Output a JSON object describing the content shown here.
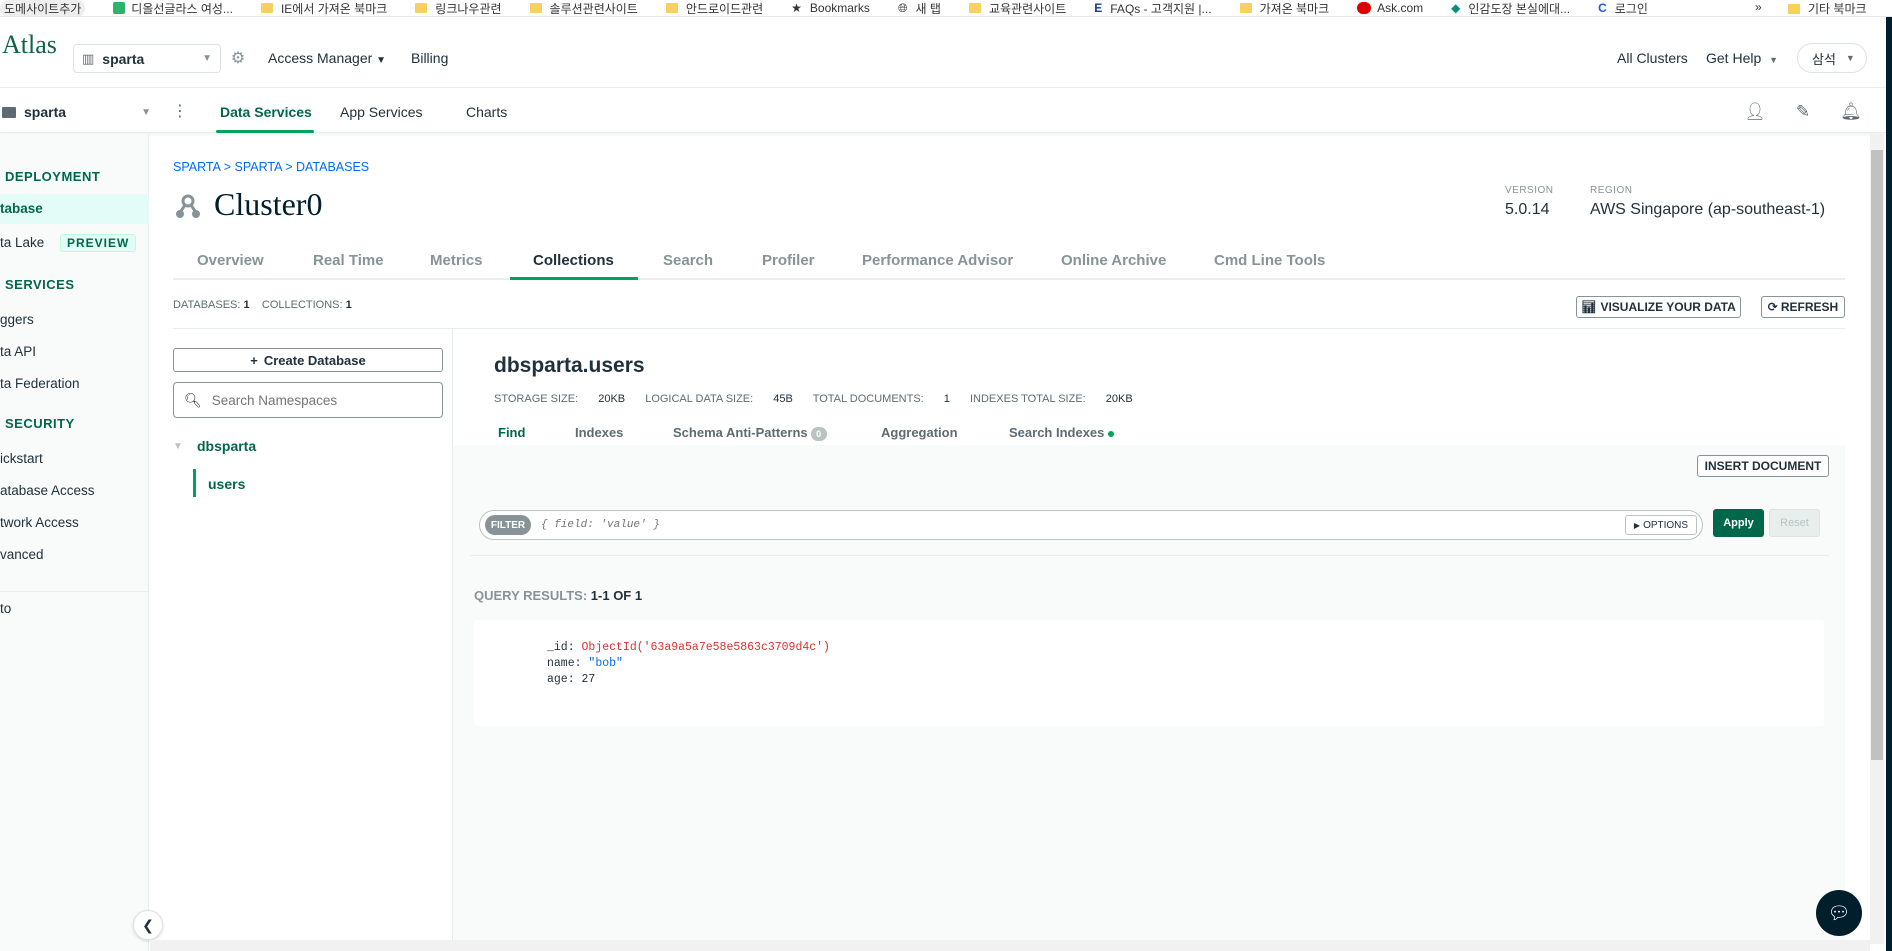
{
  "bookmarks": [
    {
      "label": "도메사이트추가",
      "icon": "none"
    },
    {
      "label": "디올선글라스 여성...",
      "icon": "page-icon"
    },
    {
      "label": "IE에서 가져온 북마크",
      "icon": "folder-icon"
    },
    {
      "label": "링크나우관련",
      "icon": "folder-icon"
    },
    {
      "label": "솔루션관련사이트",
      "icon": "folder-icon"
    },
    {
      "label": "안드로이드관련",
      "icon": "folder-icon"
    },
    {
      "label": "Bookmarks",
      "icon": "star-icon"
    },
    {
      "label": "새 탭",
      "icon": "globe-icon"
    },
    {
      "label": "교육관련사이트",
      "icon": "folder-icon"
    },
    {
      "label": "FAQs - 고객지원 |...",
      "icon": "e-icon"
    },
    {
      "label": "가져온 북마크",
      "icon": "folder-icon"
    },
    {
      "label": "Ask.com",
      "icon": "ask-icon"
    },
    {
      "label": "인감도장 본실에대...",
      "icon": "cap-icon"
    },
    {
      "label": "로그인",
      "icon": "c-icon"
    }
  ],
  "bookmarks_more": "»",
  "bookmarks_other": "기타 북마크",
  "topnav": {
    "logo": "Atlas",
    "org": "sparta",
    "access_manager": "Access Manager",
    "billing": "Billing",
    "all_clusters": "All Clusters",
    "get_help": "Get Help",
    "user": "삼석"
  },
  "projbar": {
    "project": "sparta",
    "tabs": [
      "Data Services",
      "App Services",
      "Charts"
    ]
  },
  "sidebar": {
    "deployment_head": "DEPLOYMENT",
    "database": "tabase",
    "data_lake": "ta Lake",
    "preview": "PREVIEW",
    "services_head": "SERVICES",
    "triggers": "ggers",
    "data_api": "ta API",
    "data_federation": "ta Federation",
    "security_head": "SECURITY",
    "quickstart": "ickstart",
    "database_access": "atabase Access",
    "network_access": "twork Access",
    "advanced": "vanced",
    "goto": "to"
  },
  "breadcrumb": "SPARTA > SPARTA > DATABASES",
  "cluster": {
    "name": "Cluster0",
    "version_label": "VERSION",
    "version": "5.0.14",
    "region_label": "REGION",
    "region": "AWS Singapore (ap-southeast-1)"
  },
  "cluster_tabs": [
    "Overview",
    "Real Time",
    "Metrics",
    "Collections",
    "Search",
    "Profiler",
    "Performance Advisor",
    "Online Archive",
    "Cmd Line Tools"
  ],
  "counts": {
    "databases_label": "DATABASES:",
    "databases": "1",
    "collections_label": "COLLECTIONS:",
    "collections": "1"
  },
  "buttons": {
    "visualize": "VISUALIZE YOUR DATA",
    "refresh": "REFRESH",
    "create_db": "Create Database",
    "insert_doc": "INSERT DOCUMENT",
    "options": "OPTIONS",
    "apply": "Apply",
    "reset": "Reset"
  },
  "ns": {
    "search_placeholder": "Search Namespaces",
    "db": "dbsparta",
    "coll": "users"
  },
  "collection": {
    "title": "dbsparta.users",
    "storage_label": "STORAGE SIZE:",
    "storage": "20KB",
    "logical_label": "LOGICAL DATA SIZE:",
    "logical": "45B",
    "docs_label": "TOTAL DOCUMENTS:",
    "docs": "1",
    "indexes_label": "INDEXES TOTAL SIZE:",
    "indexes": "20KB",
    "subtabs": [
      "Find",
      "Indexes",
      "Schema Anti-Patterns",
      "Aggregation",
      "Search Indexes"
    ],
    "anti_patterns_count": "0"
  },
  "filter": {
    "chip": "FILTER",
    "placeholder": "{ field: 'value' }"
  },
  "results": {
    "label": "QUERY RESULTS:",
    "range": "1-1 OF 1"
  },
  "document": {
    "id_key": "_id:",
    "id_val": "ObjectId('63a9a5a7e58e5863c3709d4c')",
    "name_key": "name:",
    "name_val": "\"bob\"",
    "age_key": "age:",
    "age_val": "27"
  },
  "colors": {
    "brand_green": "#00684a",
    "accent_green": "#00a35c",
    "link_blue": "#016bf8",
    "dark": "#001e2b"
  }
}
